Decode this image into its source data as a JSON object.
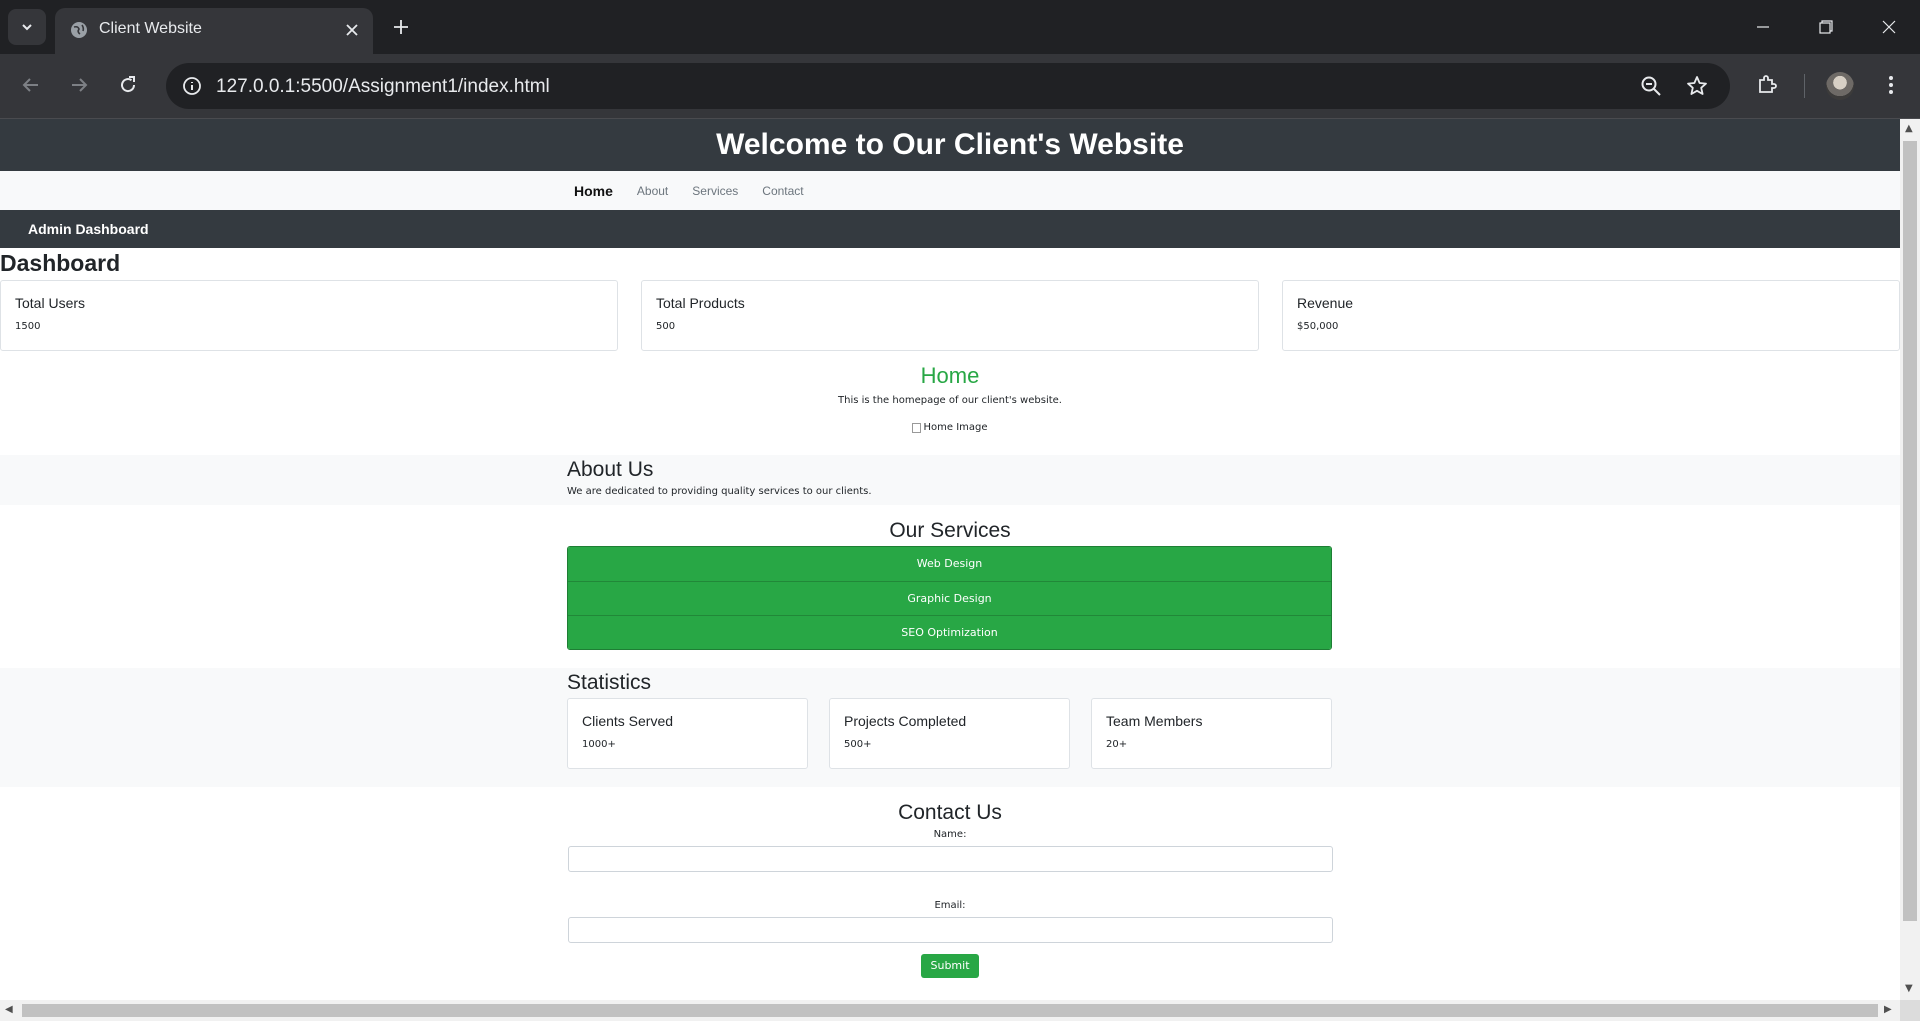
{
  "browser": {
    "tab_title": "Client Website",
    "url": "127.0.0.1:5500/Assignment1/index.html"
  },
  "page": {
    "header_title": "Welcome to Our Client's Website",
    "nav": [
      {
        "label": "Home",
        "active": true
      },
      {
        "label": "About",
        "active": false
      },
      {
        "label": "Services",
        "active": false
      },
      {
        "label": "Contact",
        "active": false
      }
    ],
    "admin_bar": "Admin Dashboard",
    "dashboard": {
      "title": "Dashboard",
      "cards": [
        {
          "title": "Total Users",
          "value": "1500"
        },
        {
          "title": "Total Products",
          "value": "500"
        },
        {
          "title": "Revenue",
          "value": "$50,000"
        }
      ]
    },
    "home": {
      "heading": "Home",
      "text": "This is the homepage of our client's website.",
      "image_alt": "Home Image"
    },
    "about": {
      "heading": "About Us",
      "text": "We are dedicated to providing quality services to our clients."
    },
    "services": {
      "heading": "Our Services",
      "items": [
        "Web Design",
        "Graphic Design",
        "SEO Optimization"
      ]
    },
    "statistics": {
      "heading": "Statistics",
      "cards": [
        {
          "title": "Clients Served",
          "value": "1000+"
        },
        {
          "title": "Projects Completed",
          "value": "500+"
        },
        {
          "title": "Team Members",
          "value": "20+"
        }
      ]
    },
    "contact": {
      "heading": "Contact Us",
      "name_label": "Name:",
      "name_value": "",
      "email_label": "Email:",
      "email_value": "",
      "submit_label": "Submit"
    }
  },
  "colors": {
    "header_bg": "#343a40",
    "accent_green": "#28a745",
    "light_bg": "#f8f9fa"
  }
}
